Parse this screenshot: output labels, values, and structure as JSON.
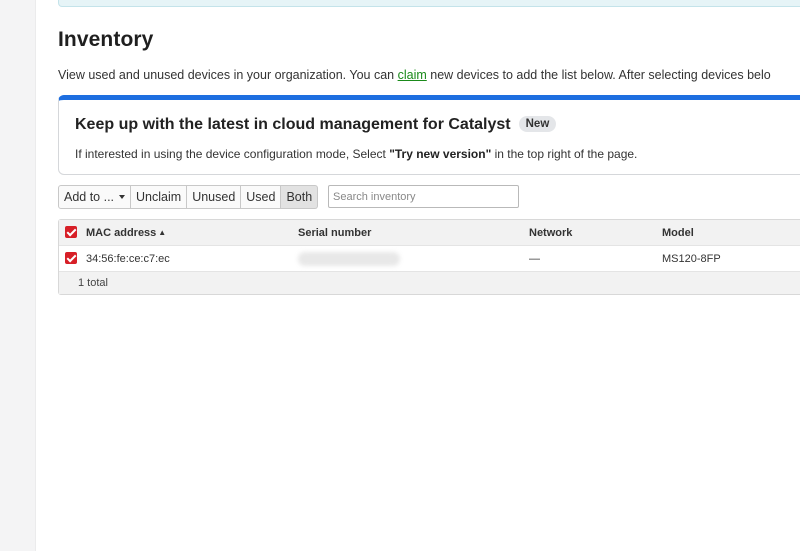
{
  "page": {
    "title": "Inventory",
    "description_before_link": "View used and unused devices in your organization. You can ",
    "description_link": "claim",
    "description_after_link": " new devices to add the list below. After selecting devices belo"
  },
  "promo": {
    "title": "Keep up with the latest in cloud management for Catalyst",
    "badge": "New",
    "text_before": "If interested in using the device configuration mode, Select ",
    "text_bold": "\"Try new version\"",
    "text_after": " in the top right of the page."
  },
  "toolbar": {
    "add_to_label": "Add to ...",
    "unclaim_label": "Unclaim",
    "unused_label": "Unused",
    "used_label": "Used",
    "both_label": "Both",
    "search_placeholder": "Search inventory"
  },
  "table": {
    "columns": {
      "mac": "MAC address",
      "sort_indicator": "▲",
      "serial": "Serial number",
      "network": "Network",
      "model": "Model"
    },
    "rows": [
      {
        "mac": "34:56:fe:ce:c7:ec",
        "serial": "",
        "network": "—",
        "model": "MS120-8FP",
        "checked": true
      }
    ],
    "footer": "1 total"
  },
  "colors": {
    "accent_blue": "#1d6ee0",
    "checkbox_red": "#d71f27",
    "link_green": "#1a8a1a"
  },
  "icons": {
    "checkbox": "checkbox-checked-icon",
    "dropdown": "caret-down-icon",
    "sort": "sort-ascending-icon"
  }
}
